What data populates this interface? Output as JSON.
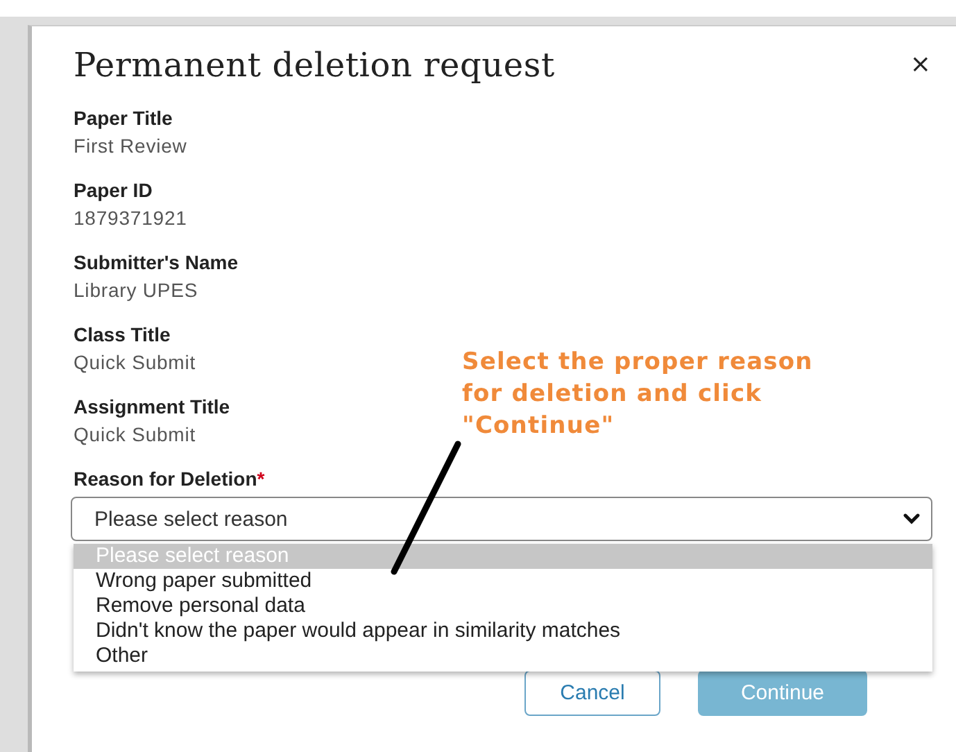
{
  "dialog": {
    "title": "Permanent deletion request",
    "close": "×"
  },
  "fields": [
    {
      "label": "Paper Title",
      "value": "First Review"
    },
    {
      "label": "Paper ID",
      "value": "1879371921"
    },
    {
      "label": "Submitter's Name",
      "value": "Library UPES"
    },
    {
      "label": "Class Title",
      "value": "Quick Submit"
    },
    {
      "label": "Assignment Title",
      "value": "Quick Submit"
    }
  ],
  "reason": {
    "label": "Reason for Deletion",
    "required_mark": "*",
    "value": "Please select reason",
    "expanded": true,
    "options": [
      {
        "label": "Please select reason",
        "selected": true
      },
      {
        "label": "Wrong paper submitted",
        "selected": false
      },
      {
        "label": "Remove personal data",
        "selected": false
      },
      {
        "label": "Didn't know the paper would appear in similarity matches",
        "selected": false
      },
      {
        "label": "Other",
        "selected": false
      }
    ]
  },
  "buttons": [
    {
      "label": "Cancel",
      "kind": "secondary",
      "disabled": false
    },
    {
      "label": "Continue",
      "kind": "primary",
      "disabled": true
    }
  ],
  "annotation": {
    "lines": [
      "Select the proper reason",
      "for deletion and click",
      "\"Continue\""
    ]
  }
}
